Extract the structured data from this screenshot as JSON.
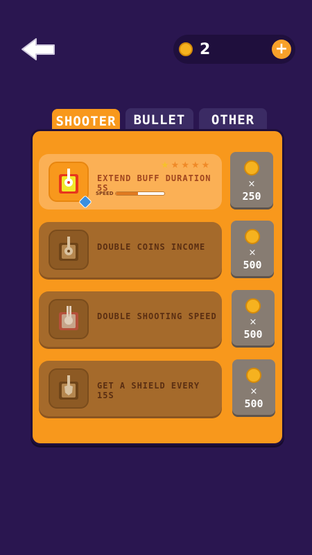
{
  "header": {
    "coins": "2",
    "add_label": "+"
  },
  "tabs": [
    {
      "label": "SHOOTER",
      "active": true
    },
    {
      "label": "BULLET",
      "active": false
    },
    {
      "label": "OTHER",
      "active": false
    }
  ],
  "upgrades": [
    {
      "title": "EXTEND BUFF DURATION 5S",
      "price": "250",
      "stars_filled": 1,
      "stars_total": 5,
      "speed_label": "SPEED",
      "speed_fraction": 0.45,
      "locked": false
    },
    {
      "title": "DOUBLE COINS INCOME",
      "price": "500",
      "locked": true
    },
    {
      "title": "DOUBLE SHOOTING SPEED",
      "price": "500",
      "locked": true
    },
    {
      "title": "GET A SHIELD EVERY 15S",
      "price": "500",
      "locked": true
    }
  ],
  "times_symbol": "×",
  "colors": {
    "background": "#2a1650",
    "accent": "#f8981c",
    "coin": "#f6b21f",
    "tab_inactive": "#3b2b64"
  },
  "icons": [
    "back-arrow-icon",
    "coin-icon",
    "plus-icon",
    "tank-icon",
    "star-icon",
    "verified-badge-icon"
  ]
}
